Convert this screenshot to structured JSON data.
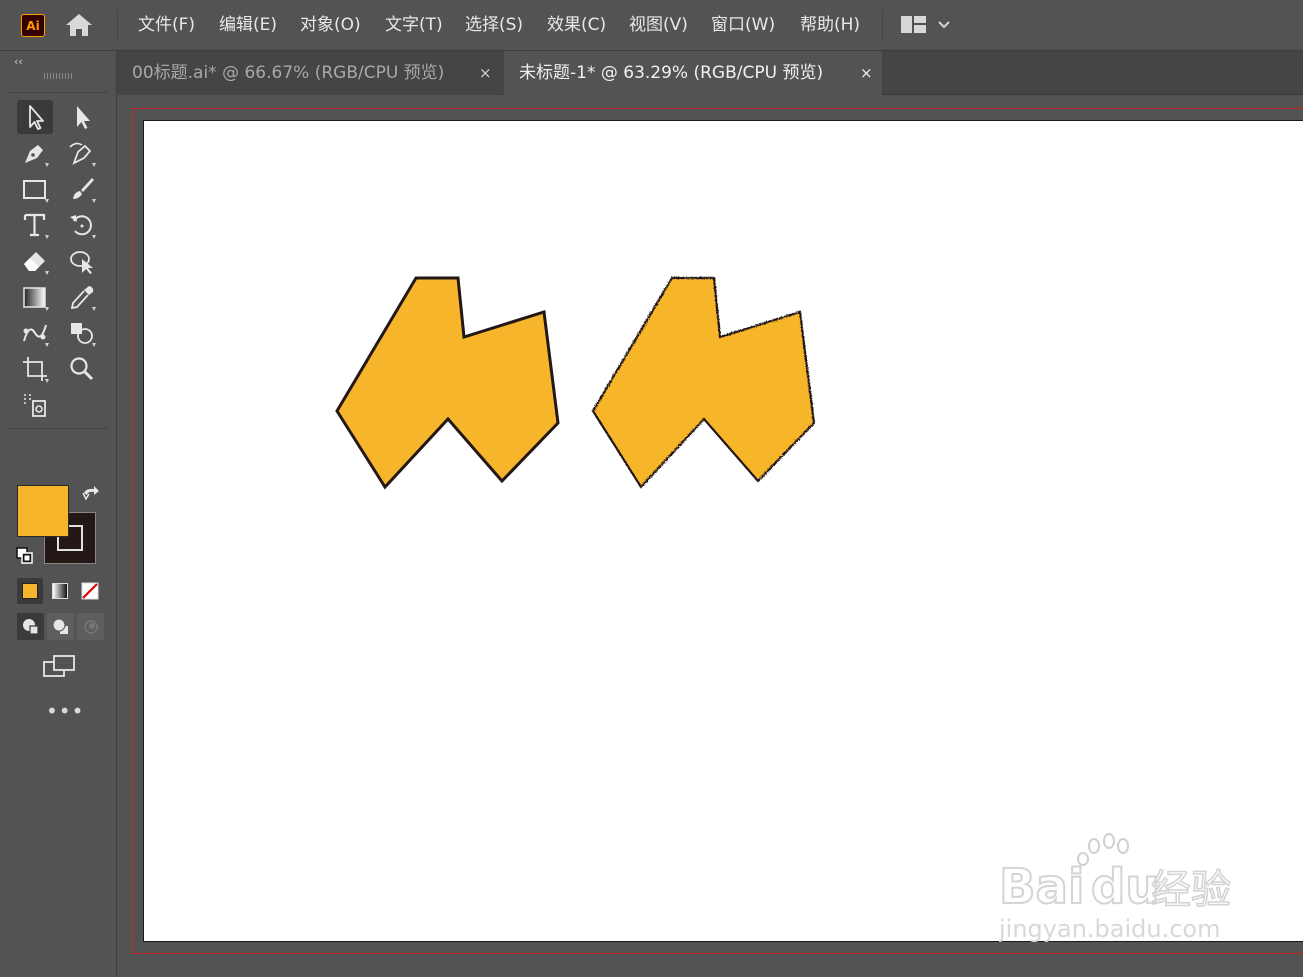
{
  "app": {
    "logo_text": "Ai"
  },
  "menu": {
    "items": [
      "文件(F)",
      "编辑(E)",
      "对象(O)",
      "文字(T)",
      "选择(S)",
      "效果(C)",
      "视图(V)",
      "窗口(W)",
      "帮助(H)"
    ]
  },
  "tabs": [
    {
      "label": "00标题.ai* @ 66.67% (RGB/CPU 预览)",
      "close": "×",
      "active": false
    },
    {
      "label": "未标题-1* @ 63.29% (RGB/CPU 预览)",
      "close": "×",
      "active": true
    }
  ],
  "toolbar": {
    "collapse": "‹‹",
    "more": "•••"
  },
  "colors": {
    "fill": "#f7b52c",
    "stroke": "#231815",
    "accent_logo": "#ff9a00",
    "bleed_guide": "#c42a2a"
  },
  "watermark": {
    "brand": "Baidu经验",
    "url": "jingyan.baidu.com"
  }
}
